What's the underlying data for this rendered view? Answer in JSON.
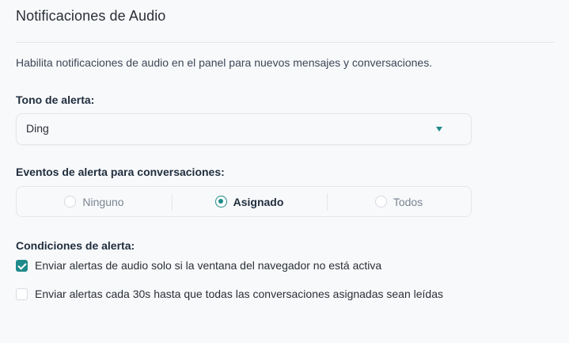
{
  "title": "Notificaciones de Audio",
  "description": "Habilita notificaciones de audio en el panel para nuevos mensajes y conversaciones.",
  "tone": {
    "label": "Tono de alerta:",
    "selected": "Ding"
  },
  "events": {
    "label": "Eventos de alerta para conversaciones:",
    "options": [
      {
        "label": "Ninguno",
        "selected": false
      },
      {
        "label": "Asignado",
        "selected": true
      },
      {
        "label": "Todos",
        "selected": false
      }
    ]
  },
  "conditions": {
    "label": "Condiciones de alerta:",
    "items": [
      {
        "label": "Enviar alertas de audio solo si la ventana del navegador no está activa",
        "checked": true
      },
      {
        "label": "Enviar alertas cada 30s hasta que todas las conversaciones asignadas sean leídas",
        "checked": false
      }
    ]
  },
  "colors": {
    "accent": "#1f8a8a",
    "background": "#f8f9fb",
    "border": "#e4e7eb"
  }
}
